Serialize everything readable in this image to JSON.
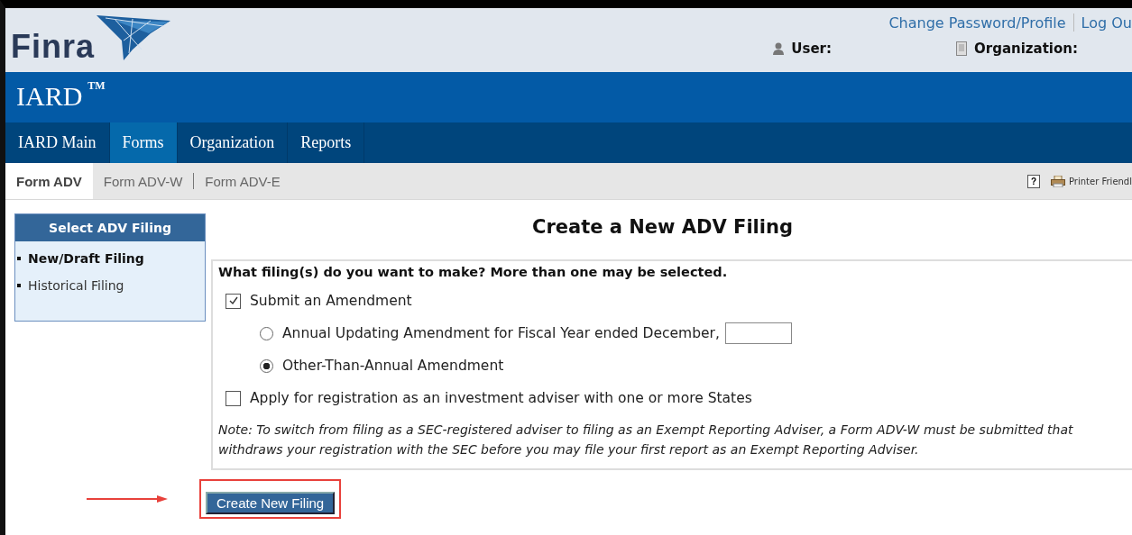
{
  "header": {
    "logo_text": "Finra",
    "links": [
      "Change Password/Profile",
      "Log Ou"
    ],
    "user_label": "User:",
    "organization_label": "Organization:"
  },
  "app_banner": {
    "title": "IARD",
    "trademark": "TM"
  },
  "nav_tabs": [
    {
      "label": "IARD Main",
      "selected": false
    },
    {
      "label": "Forms",
      "selected": true
    },
    {
      "label": "Organization",
      "selected": false
    },
    {
      "label": "Reports",
      "selected": false
    }
  ],
  "sub_tabs": [
    {
      "label": "Form ADV",
      "selected": true
    },
    {
      "label": "Form ADV-W",
      "selected": false
    },
    {
      "label": "Form ADV-E",
      "selected": false
    }
  ],
  "toolbar": {
    "help": "?",
    "printer": "Printer Friendl"
  },
  "sidebar": {
    "title": "Select ADV Filing",
    "items": [
      {
        "label": "New/Draft Filing",
        "selected": true
      },
      {
        "label": "Historical Filing",
        "selected": false
      }
    ]
  },
  "page_title": "Create a New ADV Filing",
  "form": {
    "question": "What filing(s) do you want to make? More than one may be selected.",
    "options": [
      {
        "kind": "checkbox",
        "label": "Submit an Amendment",
        "checked": true,
        "children": [
          {
            "kind": "radio",
            "label": "Annual Updating Amendment for Fiscal Year ended December,",
            "selected": false,
            "has_field": true
          },
          {
            "kind": "radio",
            "label": "Other-Than-Annual Amendment",
            "selected": true,
            "has_field": false
          }
        ]
      },
      {
        "kind": "checkbox",
        "label": "Apply for registration as an investment adviser with one or more States",
        "checked": false
      }
    ],
    "note": "Note: To switch from filing as a SEC-registered adviser to filing as an Exempt Reporting Adviser, a Form ADV-W must be submitted that withdraws your registration with the SEC before you may file your first report as an Exempt Reporting Adviser."
  },
  "create_button": {
    "label": "Create New Filing",
    "highlighted": true
  }
}
